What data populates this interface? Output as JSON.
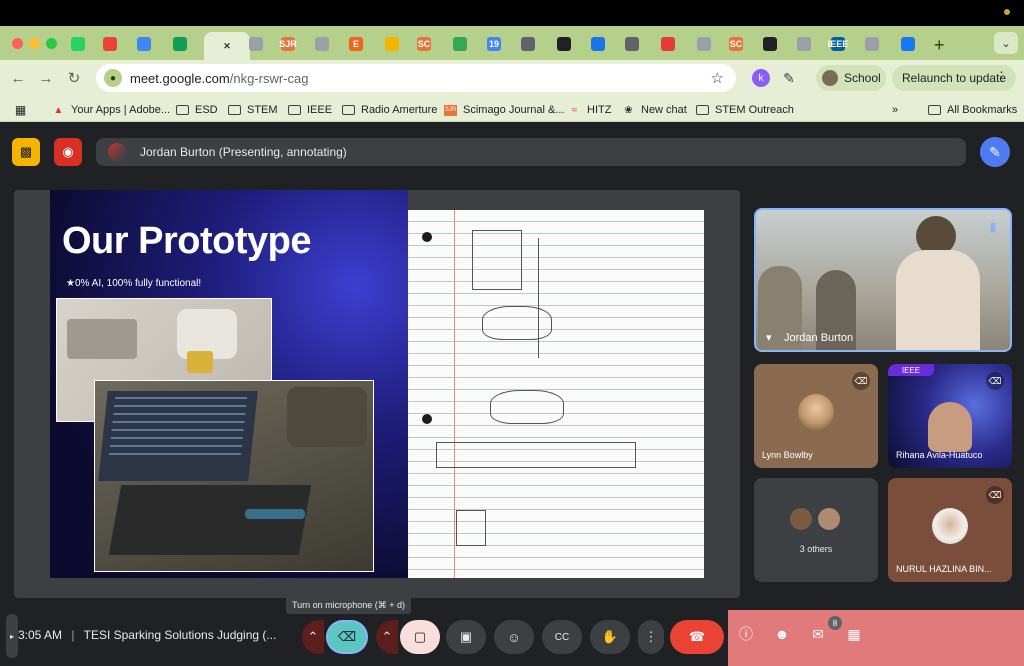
{
  "browser": {
    "tabs": [
      {
        "icon": "whatsapp-icon",
        "color": "#25d366",
        "label": ""
      },
      {
        "icon": "gmail-icon",
        "color": "#ea4335",
        "label": ""
      },
      {
        "icon": "docs-icon",
        "color": "#4285f4",
        "label": ""
      },
      {
        "icon": "sheets-icon",
        "color": "#0f9d58",
        "label": ""
      },
      {
        "icon": "close-icon",
        "color": "#333333",
        "label": ""
      },
      {
        "icon": "globe-icon",
        "color": "#9aa0a6",
        "label": ""
      },
      {
        "icon": "sjr-icon",
        "color": "#e8743b",
        "label": "SJR"
      },
      {
        "icon": "globe-icon",
        "color": "#9aa0a6",
        "label": ""
      },
      {
        "icon": "etsy-icon",
        "color": "#f1641e",
        "label": "E"
      },
      {
        "icon": "slides-icon",
        "color": "#f4b400",
        "label": ""
      },
      {
        "icon": "sc-icon",
        "color": "#e8743b",
        "label": "SC"
      },
      {
        "icon": "drive-icon",
        "color": "#34a853",
        "label": ""
      },
      {
        "icon": "calendar-icon",
        "color": "#4285f4",
        "label": "19"
      },
      {
        "icon": "doc-scan-icon",
        "color": "#5f6368",
        "label": ""
      },
      {
        "icon": "openai-icon",
        "color": "#202124",
        "label": ""
      },
      {
        "icon": "gear-icon",
        "color": "#1a73e8",
        "label": ""
      },
      {
        "icon": "image-icon",
        "color": "#5f6368",
        "label": ""
      },
      {
        "icon": "hitz-icon",
        "color": "#e53935",
        "label": ""
      },
      {
        "icon": "globe-icon",
        "color": "#9aa0a6",
        "label": ""
      },
      {
        "icon": "sc-icon",
        "color": "#e8743b",
        "label": "SC"
      },
      {
        "icon": "miro-icon",
        "color": "#202124",
        "label": ""
      },
      {
        "icon": "globe-icon",
        "color": "#9aa0a6",
        "label": ""
      },
      {
        "icon": "ieee-icon",
        "color": "#00629b",
        "label": "IEEE"
      },
      {
        "icon": "globe-icon",
        "color": "#9aa0a6",
        "label": ""
      },
      {
        "icon": "facebook-icon",
        "color": "#1877f2",
        "label": ""
      }
    ],
    "url_host": "meet.google.com",
    "url_path": "/nkg-rswr-cag",
    "profile_label": "School",
    "relaunch_label": "Relaunch to update",
    "bookmarks": [
      {
        "icon": "adobe-icon",
        "label": "Your Apps | Adobe..."
      },
      {
        "icon": "folder-icon",
        "label": "ESD"
      },
      {
        "icon": "folder-icon",
        "label": "STEM"
      },
      {
        "icon": "folder-icon",
        "label": "IEEE"
      },
      {
        "icon": "folder-icon",
        "label": "Radio Amerture"
      },
      {
        "icon": "sjr-icon",
        "label": "Scimago Journal &..."
      },
      {
        "icon": "hitz-icon",
        "label": "HITZ"
      },
      {
        "icon": "openai-icon",
        "label": "New chat"
      },
      {
        "icon": "folder-icon",
        "label": "STEM Outreach"
      }
    ],
    "all_bookmarks_label": "All Bookmarks",
    "overflow_label": "»"
  },
  "meet": {
    "presenter_label": "Jordan Burton (Presenting, annotating)",
    "slide": {
      "title": "Our Prototype",
      "subtitle": "★0% AI, 100% fully functional!"
    },
    "tiles": [
      {
        "name": "Jordan Burton",
        "pinned": true
      },
      {
        "name": "Lynn Bowlby",
        "muted": true
      },
      {
        "name": "Rihana Avila-Huatuco",
        "muted": true,
        "banner": "IEEE"
      },
      {
        "name": "3 others"
      },
      {
        "name": "NURUL HAZLINA BIN...",
        "muted": true
      }
    ],
    "tooltip": "Turn on microphone (⌘ + d)",
    "time": "3:05 AM",
    "separator": "|",
    "meeting_title": "TESI Sparking Solutions Judging (...",
    "people_count": "8"
  }
}
